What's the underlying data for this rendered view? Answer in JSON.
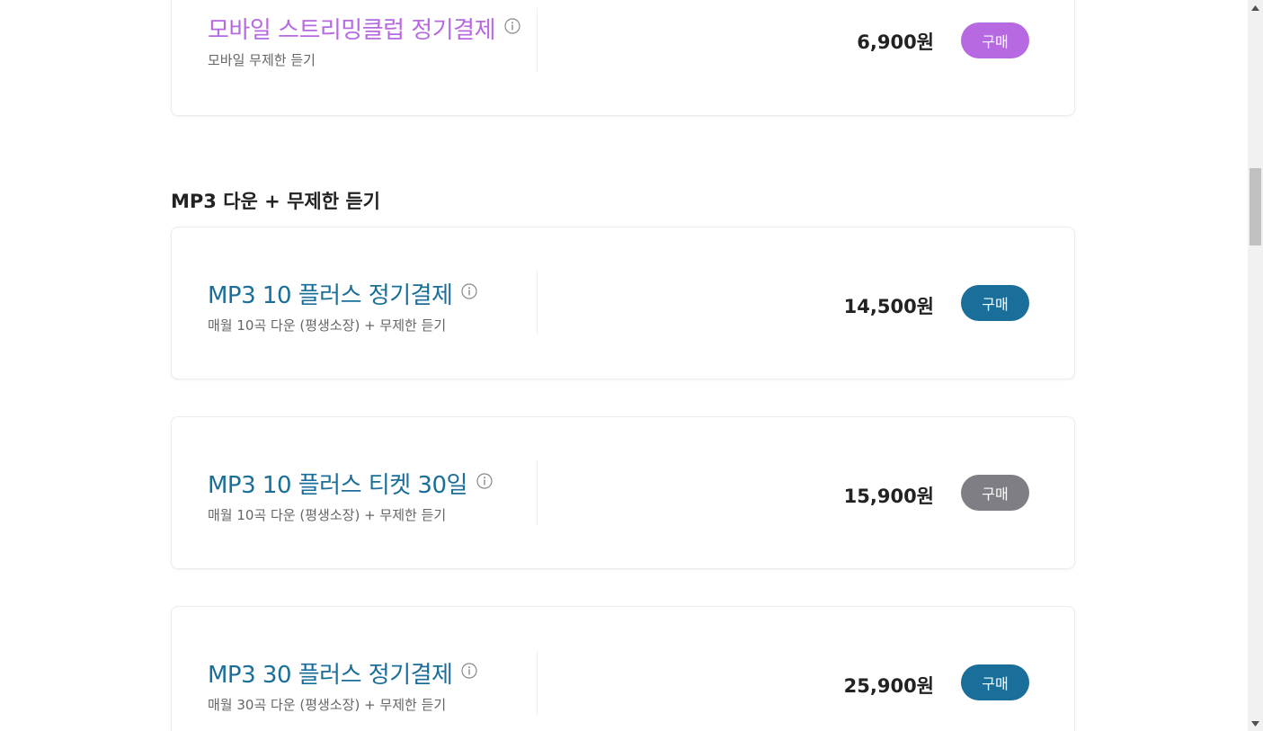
{
  "colors": {
    "purple": "#b769e2",
    "blue": "#1a6e9a",
    "gray": "#7e7e84"
  },
  "top_card": {
    "title": "모바일 스트리밍클럽 정기결제",
    "description": "모바일 무제한 듣기",
    "price": "6,900원",
    "button_label": "구매",
    "info_icon": "info-circle-icon"
  },
  "section": {
    "heading": "MP3 다운 + 무제한 듣기"
  },
  "products": [
    {
      "title": "MP3 10 플러스 정기결제",
      "description": "매월 10곡 다운 (평생소장) + 무제한 듣기",
      "price": "14,500원",
      "button_label": "구매",
      "button_state": "active"
    },
    {
      "title": "MP3 10 플러스 티켓 30일",
      "description": "매월 10곡 다운 (평생소장) + 무제한 듣기",
      "price": "15,900원",
      "button_label": "구매",
      "button_state": "inactive"
    },
    {
      "title": "MP3 30 플러스 정기결제",
      "description": "매월 30곡 다운 (평생소장) + 무제한 듣기",
      "price": "25,900원",
      "button_label": "구매",
      "button_state": "active"
    }
  ],
  "scrollbar": {
    "up_icon": "scroll-up-arrow-icon",
    "down_icon": "scroll-down-arrow-icon"
  }
}
